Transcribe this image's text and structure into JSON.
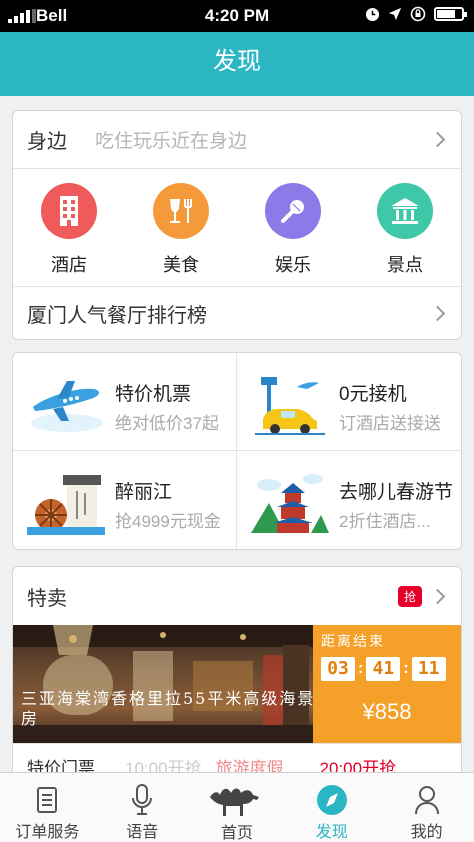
{
  "status_bar": {
    "carrier": "Bell",
    "time": "4:20 PM",
    "battery_level": 0.75
  },
  "header": {
    "title": "发现"
  },
  "nearby": {
    "label": "身边",
    "hint": "吃住玩乐近在身边",
    "categories": [
      {
        "name": "酒店",
        "icon": "hotel-icon",
        "color": "#ef5a5a"
      },
      {
        "name": "美食",
        "icon": "food-icon",
        "color": "#f59a3a"
      },
      {
        "name": "娱乐",
        "icon": "microphone-icon",
        "color": "#8a7be8"
      },
      {
        "name": "景点",
        "icon": "temple-icon",
        "color": "#3fc8a8"
      }
    ],
    "ranking": "厦门人气餐厅排行榜"
  },
  "promos": [
    {
      "title": "特价机票",
      "subtitle": "绝对低价37起",
      "icon": "airplane-icon"
    },
    {
      "title": "0元接机",
      "subtitle": "订酒店送接送",
      "icon": "airport-car-icon"
    },
    {
      "title": "醉丽江",
      "subtitle": "抢4999元现金",
      "icon": "lijiang-icon"
    },
    {
      "title": "去哪儿春游节",
      "subtitle": "2折住酒店...",
      "icon": "pagoda-icon"
    }
  ],
  "deals": {
    "label": "特卖",
    "badge": "抢",
    "hero": {
      "caption": "三亚海棠湾香格里拉55平米高级海景房",
      "timer_label": "距离结束",
      "countdown": [
        "03",
        "41",
        "11"
      ],
      "price": "¥858"
    },
    "footer": [
      "特价门票",
      "10:00开抢",
      "旅游度假",
      "20:00开抢"
    ]
  },
  "tabs": [
    {
      "label": "订单服务",
      "icon": "document-icon",
      "active": false
    },
    {
      "label": "语音",
      "icon": "microphone-icon",
      "active": false
    },
    {
      "label": "首页",
      "icon": "camel-icon",
      "active": false
    },
    {
      "label": "发现",
      "icon": "compass-icon",
      "active": true
    },
    {
      "label": "我的",
      "icon": "user-icon",
      "active": false
    }
  ],
  "colors": {
    "accent": "#2cb6c4",
    "deal_orange": "#f5a028",
    "badge_red": "#e4002b"
  }
}
